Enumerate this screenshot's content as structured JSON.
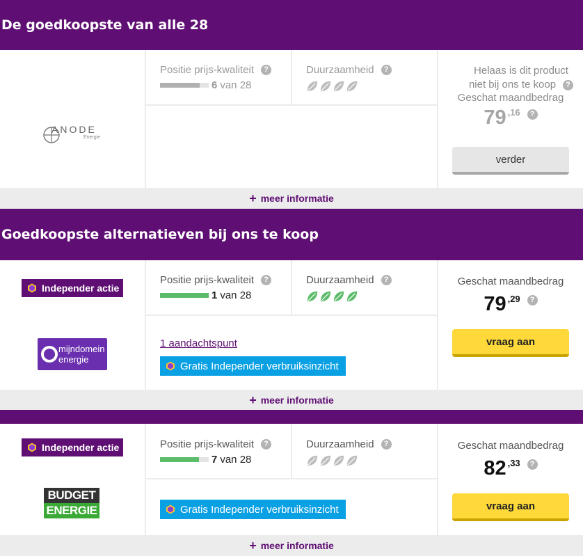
{
  "section1": {
    "title": "De goedkoopste van alle 28",
    "card": {
      "provider_logo": "ANODE",
      "provider_logo_sub": "Energie",
      "position_label": "Positie prijs-kwaliteit",
      "position": "6",
      "position_of": "van 28",
      "position_fraction": 0.82,
      "sustainability_label": "Duurzaamheid",
      "sustainability_leaves": 4,
      "unavailable_line1": "Helaas is dit product",
      "unavailable_line2": "niet bij ons te koop",
      "price_label": "Geschat maandbedrag",
      "price_int": "79",
      "price_dec": ",16",
      "button": "verder",
      "more_info": "meer informatie"
    }
  },
  "section2": {
    "title": "Goedkoopste alternatieven bij ons te koop",
    "cards": [
      {
        "badge": "Independer actie",
        "provider_logo_line1": "mijndomein",
        "provider_logo_line2": "energie",
        "position_label": "Positie prijs-kwaliteit",
        "position": "1",
        "position_of": "van 28",
        "position_fraction": 1.0,
        "sustainability_label": "Duurzaamheid",
        "sustainability_leaves": 4,
        "attention_link": "1 aandachtspunt",
        "gratis": "Gratis Independer verbruiksinzicht",
        "price_label": "Geschat maandbedrag",
        "price_int": "79",
        "price_dec": ",29",
        "button": "vraag aan",
        "more_info": "meer informatie"
      },
      {
        "badge": "Independer actie",
        "provider_logo_line1": "BUDGET",
        "provider_logo_line2": "ENERGIE",
        "position_label": "Positie prijs-kwaliteit",
        "position": "7",
        "position_of": "van 28",
        "position_fraction": 0.8,
        "sustainability_label": "Duurzaamheid",
        "sustainability_leaves": 4,
        "gratis": "Gratis Independer verbruiksinzicht",
        "price_label": "Geschat maandbedrag",
        "price_int": "82",
        "price_dec": ",33",
        "button": "vraag aan",
        "more_info": "meer informatie"
      }
    ]
  },
  "icons": {
    "help": "?",
    "plus": "+"
  },
  "colors": {
    "brand_purple": "#5f0f73",
    "bar_grey": "#b0b0b0",
    "bar_green": "#5cbc6a",
    "leaf_green": "#5cbc6a",
    "leaf_grey": "#bdbdbd",
    "button_yellow": "#ffd93a",
    "gratis_blue": "#0aa0e4"
  }
}
